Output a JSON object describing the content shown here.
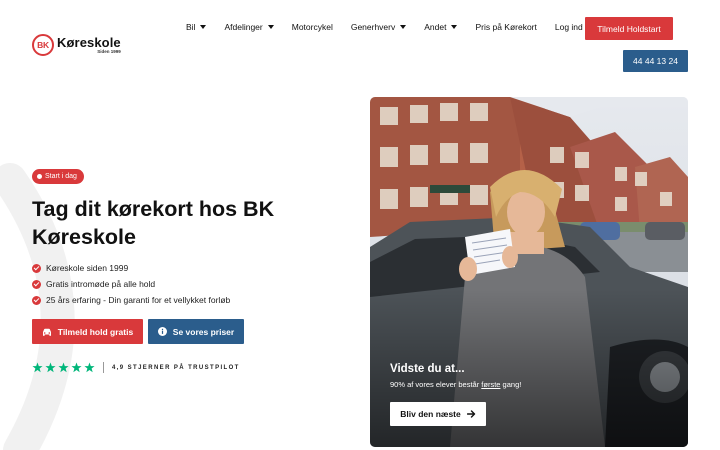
{
  "logo": {
    "badge": "BK",
    "name": "Køreskole",
    "sub": "Siden 1999"
  },
  "nav": [
    {
      "label": "Bil",
      "dropdown": true
    },
    {
      "label": "Afdelinger",
      "dropdown": true
    },
    {
      "label": "Motorcykel",
      "dropdown": false
    },
    {
      "label": "Generhverv",
      "dropdown": true
    },
    {
      "label": "Andet",
      "dropdown": true
    },
    {
      "label": "Pris på Kørekort",
      "dropdown": false
    },
    {
      "label": "Log ind",
      "dropdown": false
    }
  ],
  "header": {
    "holdstart_label": "Tilmeld Holdstart",
    "phone_label": "44 44 13 24"
  },
  "hero": {
    "badge": "Start i dag",
    "title": "Tag dit kørekort hos BK Køreskole",
    "features": [
      "Køreskole siden 1999",
      "Gratis intromøde på alle hold",
      "25 års erfaring - Din garanti for et vellykket forløb"
    ],
    "primary_button": "Tilmeld hold gratis",
    "secondary_button": "Se vores priser",
    "trustpilot": {
      "rating_stars": 5,
      "text": "4,9 STJERNER PÅ TRUSTPILOT"
    }
  },
  "photo_card": {
    "caption_title": "Vidste du at...",
    "caption_before": "90% af vores elever består ",
    "caption_underlined": "første",
    "caption_after": " gang!",
    "button_label": "Bliv den næste"
  },
  "colors": {
    "brand_red": "#d9393b",
    "brand_blue": "#2b5d8c",
    "trustpilot_green": "#00b67a"
  }
}
